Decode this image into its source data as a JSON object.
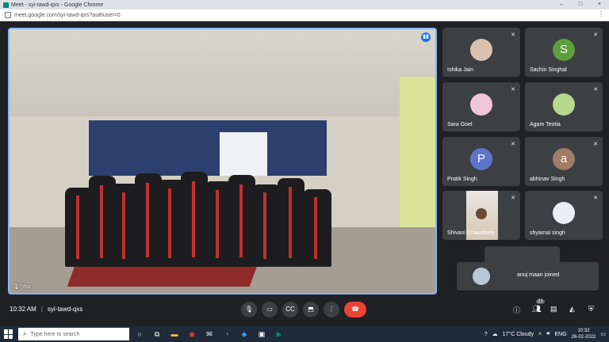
{
  "browser": {
    "title": "Meet - syi-tawd-qxs - Google Chrome",
    "url": "meet.google.com/syi-tawd-qxs?authuser=0",
    "window_controls": [
      "–",
      "□",
      "×"
    ]
  },
  "main_video": {
    "name": "You"
  },
  "participants": [
    {
      "name": "Ishika Jain",
      "avatar": "photo",
      "muted": true
    },
    {
      "name": "Sachin Singhal",
      "avatar": "S",
      "color": "#5e9e3b",
      "muted": true
    },
    {
      "name": "Sara Goel",
      "avatar": "photo",
      "muted": true
    },
    {
      "name": "Agam Teotia",
      "avatar": "photo",
      "muted": true
    },
    {
      "name": "Pratik Singh",
      "avatar": "P",
      "color": "#5e74c9",
      "muted": true
    },
    {
      "name": "abhinav Singh",
      "avatar": "a",
      "color": "#a07b66",
      "muted": true
    },
    {
      "name": "Shivani Chaudhary",
      "avatar": "video",
      "muted": true
    },
    {
      "name": "shyamal singh",
      "avatar": "photo",
      "muted": true
    }
  ],
  "toast": {
    "text": "anuj maan joined"
  },
  "meeting": {
    "time": "10:32 AM",
    "code": "syi-tawd-qxs",
    "participant_count": "21"
  },
  "controls": [
    "mic-icon",
    "camera-icon",
    "captions-icon",
    "present-icon",
    "more-icon",
    "end-call-icon"
  ],
  "taskbar": {
    "search_placeholder": "Type here to search",
    "weather": "17°C Cloudy",
    "lang": "ENG",
    "clock_time": "10:32",
    "clock_date": "26-02-2022"
  }
}
